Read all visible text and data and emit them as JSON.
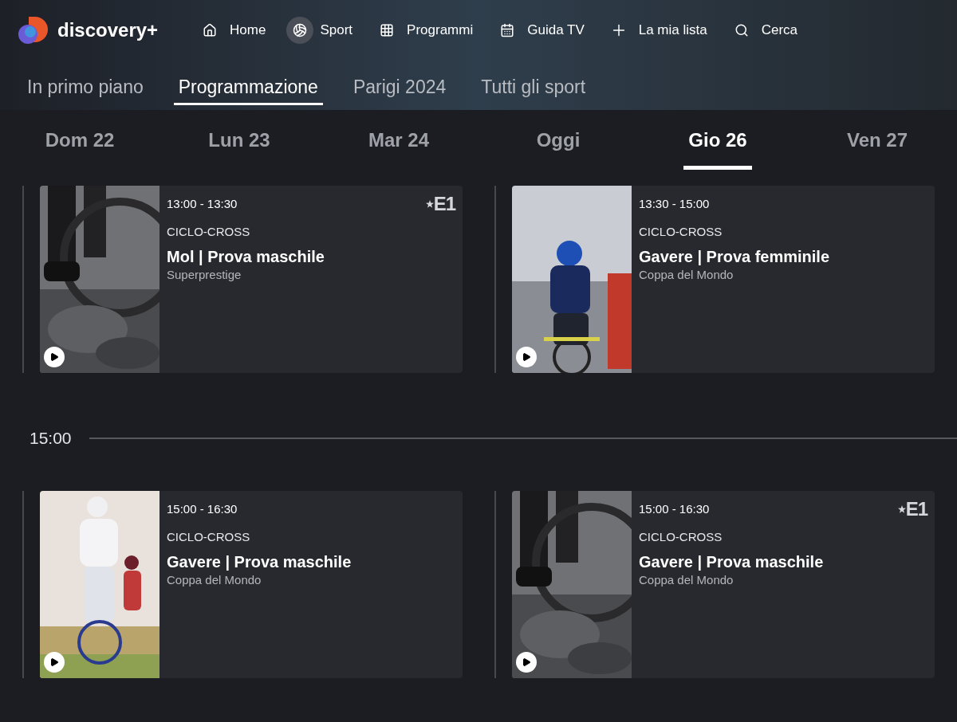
{
  "logo": {
    "text": "discovery+"
  },
  "nav": [
    {
      "label": "Home",
      "selected": false
    },
    {
      "label": "Sport",
      "selected": true
    },
    {
      "label": "Programmi",
      "selected": false
    },
    {
      "label": "Guida TV",
      "selected": false
    },
    {
      "label": "La mia lista",
      "selected": false
    },
    {
      "label": "Cerca",
      "selected": false
    }
  ],
  "subtabs": [
    {
      "label": "In primo piano",
      "selected": false
    },
    {
      "label": "Programmazione",
      "selected": true
    },
    {
      "label": "Parigi 2024",
      "selected": false
    },
    {
      "label": "Tutti gli sport",
      "selected": false
    }
  ],
  "days": [
    {
      "label": "Dom 22",
      "selected": false
    },
    {
      "label": "Lun 23",
      "selected": false
    },
    {
      "label": "Mar 24",
      "selected": false
    },
    {
      "label": "Oggi",
      "selected": false
    },
    {
      "label": "Gio 26",
      "selected": true
    },
    {
      "label": "Ven 27",
      "selected": false
    }
  ],
  "slots": [
    {
      "programs": [
        {
          "time": "13:00 - 13:30",
          "sport": "CICLO-CROSS",
          "title": "Mol | Prova maschile",
          "subtitle": "Superprestige",
          "channel": "E1"
        },
        {
          "time": "13:30 - 15:00",
          "sport": "CICLO-CROSS",
          "title": "Gavere | Prova femminile",
          "subtitle": "Coppa del Mondo"
        }
      ]
    },
    {
      "time_label": "15:00",
      "programs": [
        {
          "time": "15:00 - 16:30",
          "sport": "CICLO-CROSS",
          "title": "Gavere | Prova maschile",
          "subtitle": "Coppa del Mondo"
        },
        {
          "time": "15:00 - 16:30",
          "sport": "CICLO-CROSS",
          "title": "Gavere | Prova maschile",
          "subtitle": "Coppa del Mondo",
          "channel": "E1"
        }
      ]
    }
  ]
}
